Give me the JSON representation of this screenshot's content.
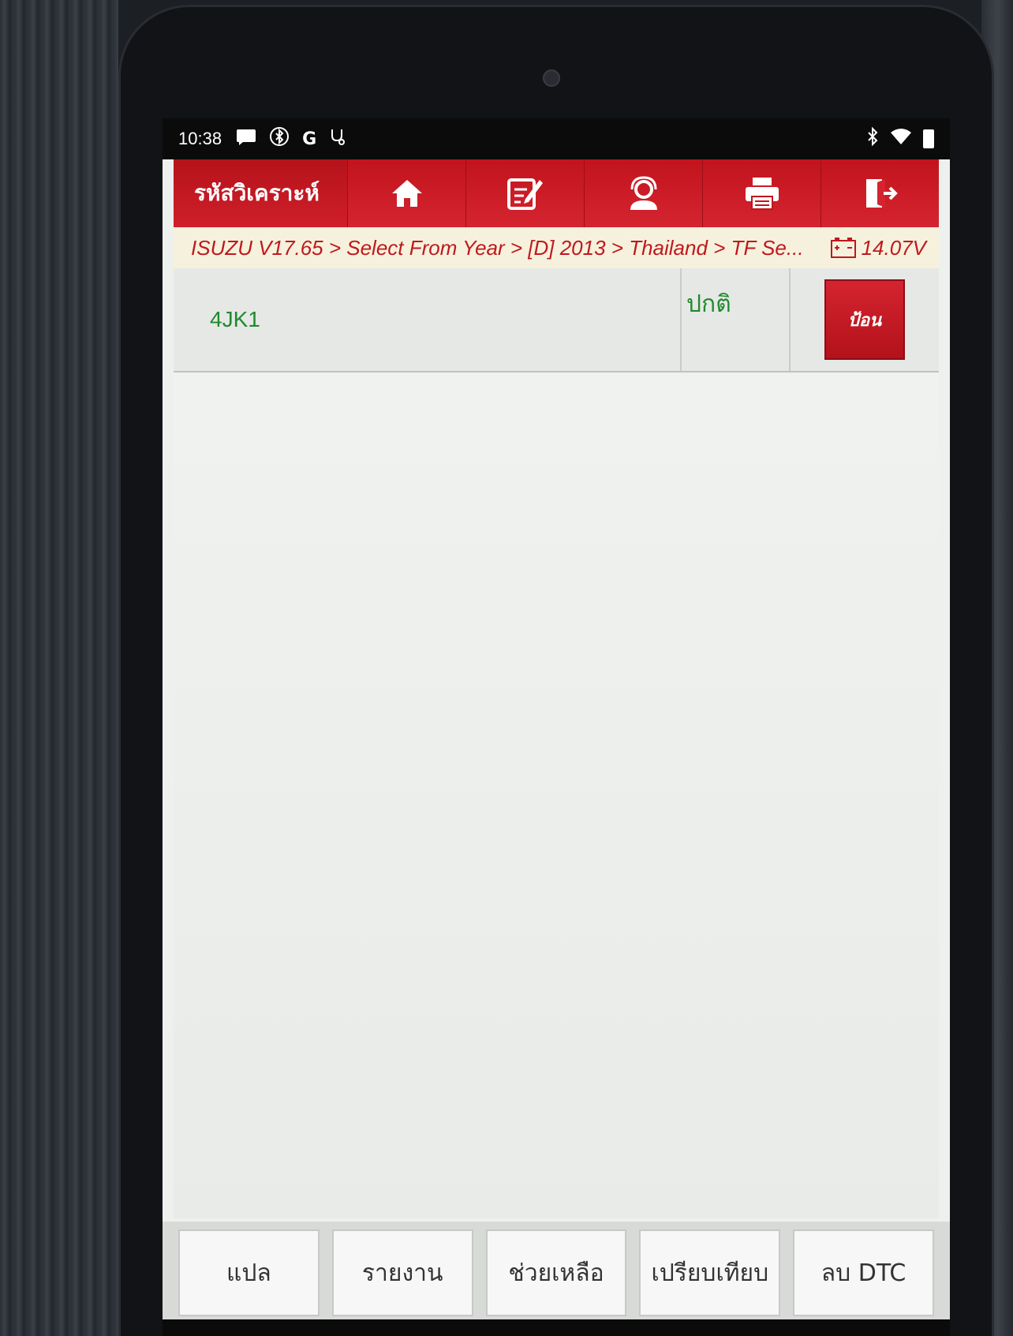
{
  "status_bar": {
    "time": "10:38",
    "left_icons": [
      "message-icon",
      "bluetooth-circle-icon",
      "google-icon",
      "stethoscope-icon"
    ],
    "right_icons": [
      "bluetooth-icon",
      "wifi-icon",
      "battery-icon"
    ],
    "g_label": "G"
  },
  "toolbar": {
    "title": "รหัสวิเคราะห์",
    "buttons": [
      "home-icon",
      "edit-icon",
      "support-icon",
      "print-icon",
      "exit-icon"
    ]
  },
  "breadcrumb": {
    "path": "ISUZU V17.65 > Select From Year > [D] 2013 > Thailand > TF Se...",
    "voltage": "14.07V"
  },
  "results": {
    "rows": [
      {
        "name": "4JK1",
        "status": "ปกติ",
        "action": "ป้อน"
      }
    ]
  },
  "bottom_buttons": [
    "แปล",
    "รายงาน",
    "ช่วยเหลือ",
    "เปรียบเทียบ",
    "ลบ DTC"
  ],
  "colors": {
    "accent_red": "#cf1f2a",
    "status_green": "#1f8a2c",
    "breadcrumb_bg": "#f6f1dc"
  }
}
